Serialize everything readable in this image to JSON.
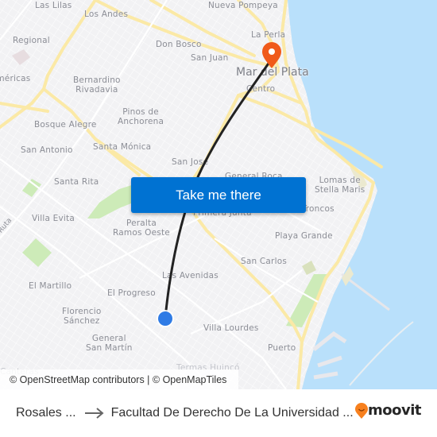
{
  "map": {
    "colors": {
      "land": "#f2f2f4",
      "water": "#b9e0fb",
      "major_road": "#fbe9a6",
      "park": "#cdebb8",
      "route": "#222222",
      "destination_pin": "#f05a1a",
      "origin_dot": "#2f7be5"
    },
    "labels": {
      "las_lilas": "Las Lilas",
      "los_andes": "Los Andes",
      "nueva_pompeya": "Nueva Pompeya",
      "regional": "Regional",
      "la_perla": "La Perla",
      "don_bosco": "Don Bosco",
      "san_juan": "San Juan",
      "americas": "Américas",
      "mar_del_plata": "Mar del Plata",
      "bernardino_rivadavia": "Bernardino\nRivadavia",
      "centro": "Centro",
      "pinos_de_anchorena": "Pinos de\nAnchorena",
      "bosque_alegre": "Bosque Alegre",
      "san_antonio": "San Antonio",
      "santa_monica": "Santa Mónica",
      "san_jose": "San José",
      "general_roca": "General Roca",
      "lomas_de_stella_maris": "Lomas de\nStella Maris",
      "santa_rita": "Santa Rita",
      "primera_junta": "Primera Junta",
      "los_troncos": "Los Troncos",
      "villa_evita": "Villa Evita",
      "peralta_ramos_oeste": "Peralta\nRamos Oeste",
      "playa_grande": "Playa Grande",
      "san_carlos": "San Carlos",
      "las_avenidas": "Las Avenidas",
      "el_martillo": "El Martillo",
      "el_progreso": "El Progreso",
      "florencio_sanchez": "Florencio\nSánchez",
      "villa_lourdes": "Villa Lourdes",
      "general_san_martin": "General\nSan Martín",
      "puerto": "Puerto",
      "termas_huinco": "Termas Huincó",
      "canteras": "Canteras",
      "ruta": "Ruta"
    },
    "markers": {
      "destination_icon": "map-pin-icon",
      "origin_icon": "location-dot-icon"
    }
  },
  "cta": {
    "label": "Take me there"
  },
  "attribution": "© OpenStreetMap contributors | © OpenMapTiles",
  "footer": {
    "origin": "Rosales ...",
    "arrow_icon": "arrow-right-icon",
    "destination": "Facultad De Derecho De La Universidad ...",
    "logo_text": "moovit",
    "logo_icon": "moovit-pin-icon",
    "logo_color": "#f7801e"
  }
}
